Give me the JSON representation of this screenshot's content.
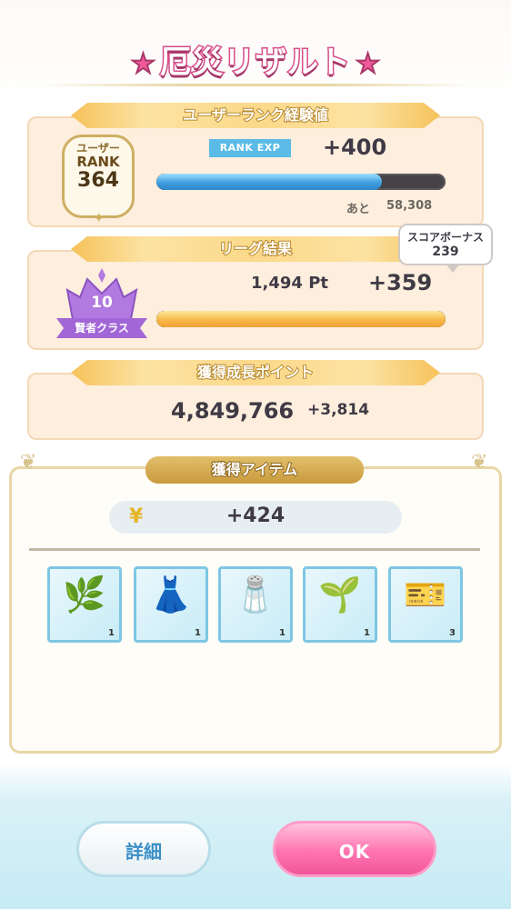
{
  "title": "厄災リザルト",
  "title_star": "★",
  "rank_section": {
    "header": "ユーザーランク経験値",
    "badge_line1": "ユーザー",
    "badge_line2": "RANK",
    "badge_value": "364",
    "label": "RANK EXP",
    "gain": "+400",
    "remaining_label": "あと",
    "remaining_value": "58,308",
    "progress_fraction": 0.78
  },
  "league_section": {
    "header": "リーグ結果",
    "crown_number": "10",
    "class_label": "賢者クラス",
    "points": "1,494 Pt",
    "gain": "+359",
    "progress_fraction": 1.0,
    "score_bonus_label": "スコアボーナス",
    "score_bonus_value": "239"
  },
  "growth_section": {
    "header": "獲得成長ポイント",
    "total": "4,849,766",
    "gain": "+3,814"
  },
  "items_section": {
    "header": "獲得アイテム",
    "money_icon": "mana-coin-icon",
    "money_value": "+424",
    "items": [
      {
        "icon": "herb-icon",
        "glyph": "🌿",
        "count": "1"
      },
      {
        "icon": "cloth-icon",
        "glyph": "👗",
        "count": "1"
      },
      {
        "icon": "salt-box-icon",
        "glyph": "🧂",
        "count": "1"
      },
      {
        "icon": "seaweed-icon",
        "glyph": "🌱",
        "count": "1"
      },
      {
        "icon": "ticket-icon",
        "glyph": "🎫",
        "count": "3"
      }
    ]
  },
  "buttons": {
    "detail_label": "詳細",
    "ok_label": "OK"
  },
  "colors": {
    "accent_pink": "#f05a9a",
    "panel_bg": "#fdeedd",
    "exp_bar": "#3e9ee0",
    "league_bar": "#f7b94a"
  }
}
